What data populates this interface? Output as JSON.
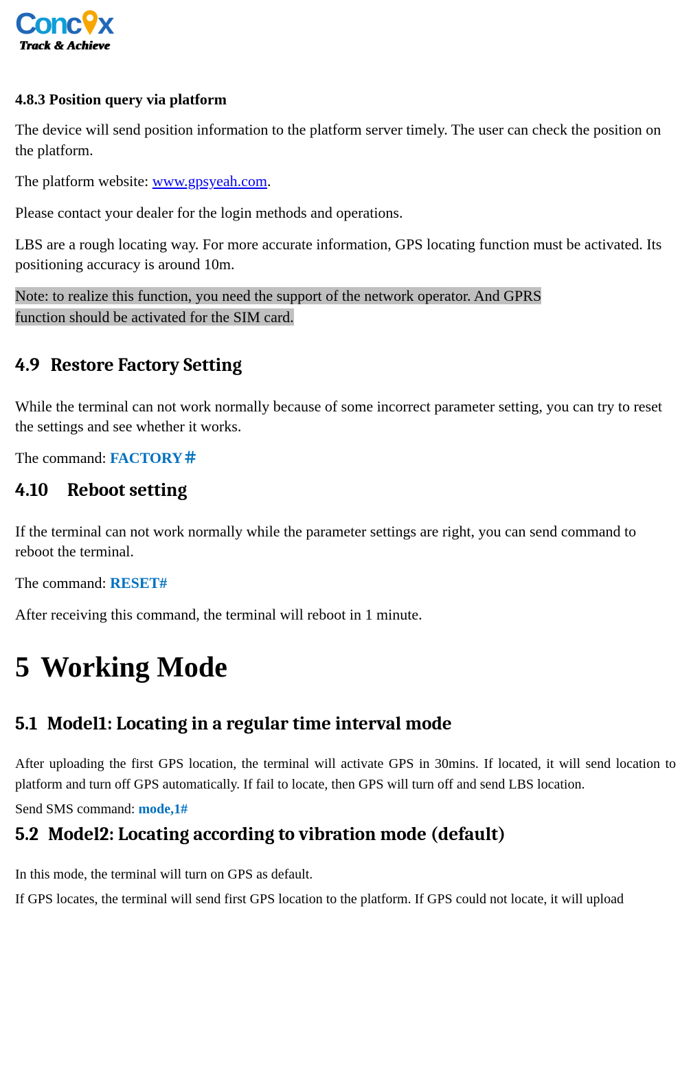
{
  "logo": {
    "brand_c1": "C",
    "brand_o": "o",
    "brand_n": "n",
    "brand_c2": "c",
    "brand_x": "x",
    "tagline": "Track & Achieve"
  },
  "s483": {
    "heading": "4.8.3 Position query via platform",
    "p1": "The device will send position information to the platform server timely. The user can check the position on the platform.",
    "p2_prefix": "The platform website: ",
    "p2_link": "www.gpsyeah.com",
    "p2_suffix": ".",
    "p3": "Please contact your dealer for the login methods and operations.",
    "p4": "LBS are a rough locating way. For more accurate information, GPS locating function must be activated. Its positioning accuracy is around 10m.",
    "note_line1": "Note: to realize this function, you need the support of the network operator. And GPRS",
    "note_line2": "function should be activated for the SIM card."
  },
  "s49": {
    "num": "4.9",
    "title": "Restore Factory Setting",
    "p1": "While the terminal can not work normally because of some incorrect parameter setting, you can try to reset the settings and see whether it works.",
    "cmd_prefix": "The command: ",
    "cmd": "FACTORY＃"
  },
  "s410": {
    "num": "4.10",
    "title": "Reboot setting",
    "p1": "If the terminal can not work normally while the parameter settings are right, you can send command to reboot the terminal.",
    "cmd_prefix": "The command: ",
    "cmd": "RESET#",
    "p2": "After receiving this command, the terminal will reboot in 1 minute."
  },
  "s5": {
    "num": "5",
    "title": "Working Mode"
  },
  "s51": {
    "num": "5.1",
    "title": "Model1: Locating in a regular time interval mode",
    "p1": "After uploading the first GPS location, the terminal will activate GPS in 30mins. If located, it will send location to platform and turn off GPS automatically. If fail to locate, then GPS will turn off and send LBS location.",
    "p2_prefix": "Send SMS command: ",
    "cmd": "mode,1#"
  },
  "s52": {
    "num": "5.2",
    "title": "Model2: Locating according to vibration mode (default)",
    "p1": "In this mode, the terminal will turn on GPS as default.",
    "p2": "If GPS locates, the terminal will send first GPS location to the platform. If GPS could not locate, it will upload"
  }
}
